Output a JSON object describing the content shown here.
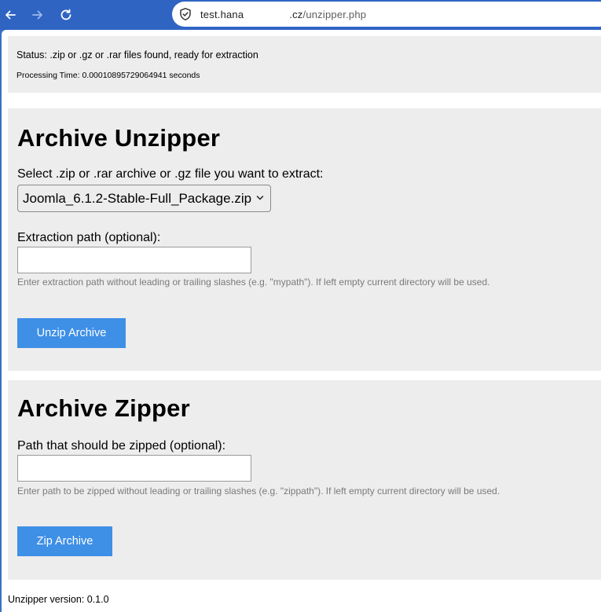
{
  "browser": {
    "url_host_prefix": "test.hana",
    "url_host_suffix": ".cz",
    "url_path": "/unzipper.php"
  },
  "status": {
    "text": "Status: .zip or .gz or .rar files found, ready for extraction",
    "processing_time": "Processing Time: 0.00010895729064941 seconds"
  },
  "unzipper": {
    "title": "Archive Unzipper",
    "select_label": "Select .zip or .rar archive or .gz file you want to extract:",
    "selected_archive": "Joomla_6.1.2-Stable-Full_Package.zip",
    "path_label": "Extraction path (optional):",
    "path_value": "",
    "path_help": "Enter extraction path without leading or trailing slashes (e.g. \"mypath\"). If left empty current directory will be used.",
    "button_label": "Unzip Archive"
  },
  "zipper": {
    "title": "Archive Zipper",
    "path_label": "Path that should be zipped (optional):",
    "path_value": "",
    "path_help": "Enter path to be zipped without leading or trailing slashes (e.g. \"zippath\"). If left empty current directory will be used.",
    "button_label": "Zip Archive"
  },
  "footer": {
    "version": "Unzipper version: 0.1.0"
  },
  "colors": {
    "chrome": "#2f64c3",
    "accent_button": "#3e8fe6",
    "panel_bg": "#ededed",
    "help_text": "#7a7a7a"
  },
  "icons": [
    "back-arrow-icon",
    "forward-arrow-icon",
    "reload-icon",
    "shield-icon",
    "chevron-down-icon"
  ]
}
